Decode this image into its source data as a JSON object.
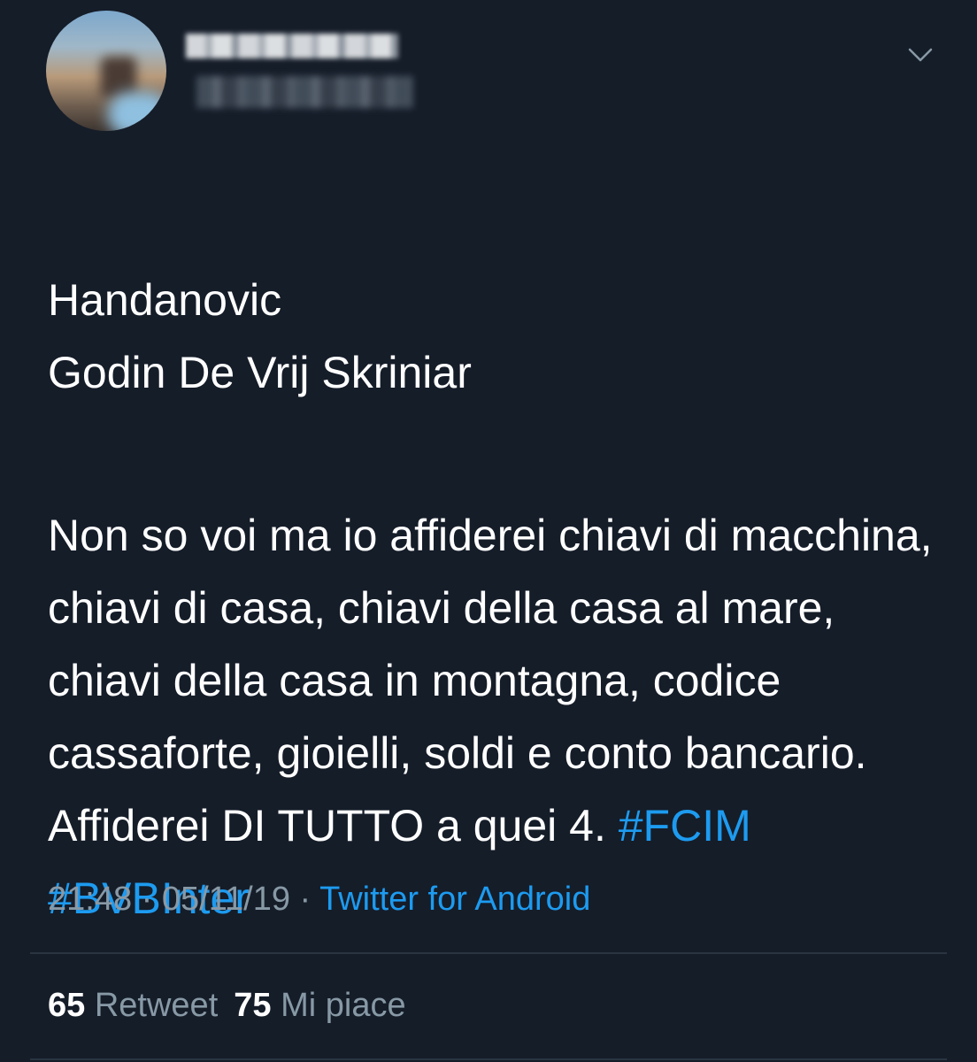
{
  "tweet": {
    "author": {
      "avatar_icon": "user-avatar-blurred",
      "name_redacted": true,
      "handle_redacted": true
    },
    "menu_icon": "chevron-down-icon",
    "text": {
      "line1": "Handanovic",
      "line2": "Godin De Vrij Skriniar",
      "body": "Non so voi ma io affiderei chiavi di macchina, chiavi di casa, chiavi della casa al mare, chiavi della casa in montagna, codice cassaforte, gioielli, soldi e conto bancario. Affiderei DI TUTTO a quei 4. ",
      "hashtag1": "#FCIM",
      "hashtag2": "#BVBInter"
    },
    "meta": {
      "time": "21:48",
      "separator": " · ",
      "date": "05/11/19",
      "source": "Twitter for Android"
    },
    "stats": {
      "retweets_count": "65",
      "retweets_label": "Retweet",
      "likes_count": "75",
      "likes_label": "Mi piace"
    }
  },
  "colors": {
    "background": "#151d29",
    "text": "#ffffff",
    "secondary": "#8899a6",
    "accent": "#1d9bf0",
    "divider": "#2a3441"
  }
}
